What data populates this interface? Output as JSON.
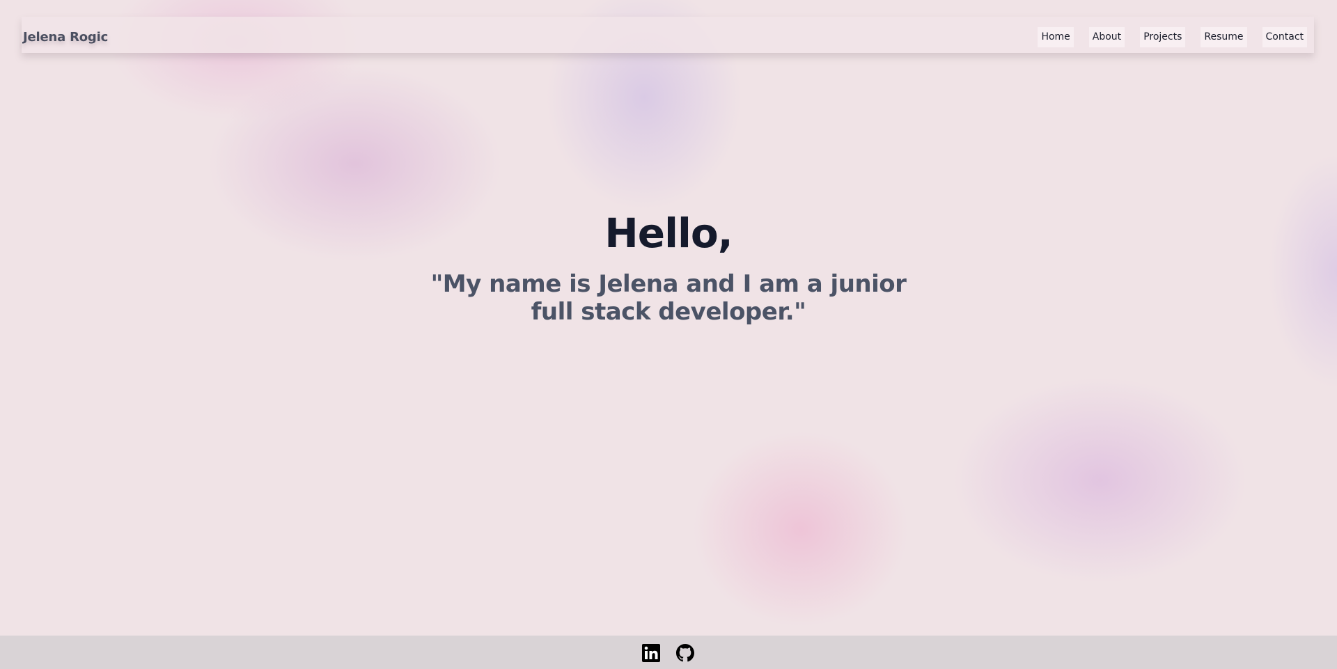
{
  "brand": {
    "name": "Jelena Rogic"
  },
  "nav": {
    "links": [
      {
        "label": "Home"
      },
      {
        "label": "About"
      },
      {
        "label": "Projects"
      },
      {
        "label": "Resume"
      },
      {
        "label": "Contact"
      }
    ]
  },
  "hero": {
    "title": "Hello,",
    "subtitle": "\"My name is Jelena and I am a junior full stack developer.\""
  },
  "footer": {
    "social": [
      {
        "icon": "linkedin-icon"
      },
      {
        "icon": "github-icon"
      }
    ]
  },
  "colors": {
    "background": "#f0e3e6",
    "footer": "#d9d3d6",
    "title": "#151a2c",
    "subtitle": "#4b5366",
    "brand": "#4b4f60"
  }
}
